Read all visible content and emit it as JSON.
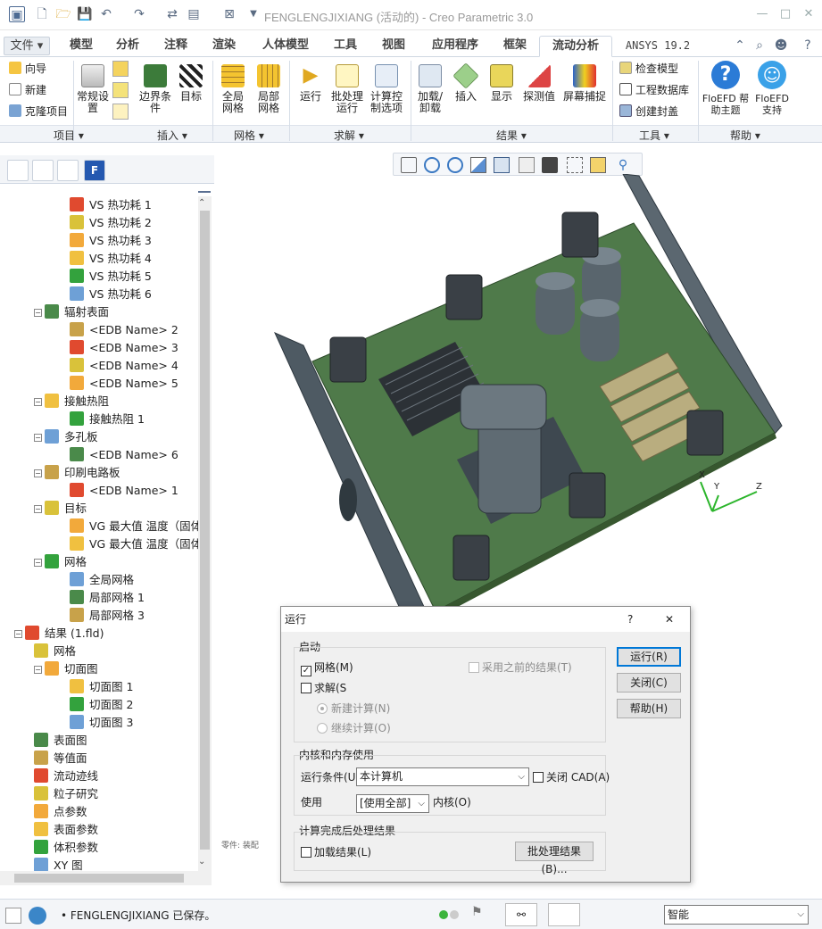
{
  "titlebar": {
    "title": "FENGLENGJIXIANG (活动的) - Creo Parametric 3.0"
  },
  "tabs": [
    "文件",
    "模型",
    "分析",
    "注释",
    "渲染",
    "人体模型",
    "工具",
    "视图",
    "应用程序",
    "框架",
    "流动分析",
    "ANSYS 19.2"
  ],
  "active_tab": "流动分析",
  "ribbon": {
    "project": {
      "items": [
        "向导",
        "新建",
        "克隆项目"
      ],
      "group": "项目"
    },
    "insert": {
      "buttons": [
        "常规设置",
        "边界条件",
        "目标"
      ],
      "group": "插入"
    },
    "mesh": {
      "buttons": [
        "全局网格",
        "局部网格"
      ],
      "group": "网格"
    },
    "solve": {
      "buttons": [
        "运行",
        "批处理运行",
        "计算控制选项"
      ],
      "group": "求解"
    },
    "results": {
      "buttons": [
        "加载/卸载",
        "插入",
        "显示",
        "探测值",
        "屏幕捕捉"
      ],
      "group": "结果"
    },
    "tools": {
      "items": [
        "检查模型",
        "工程数据库",
        "创建封盖"
      ],
      "group": "工具"
    },
    "help": {
      "buttons": [
        "FloEFD 帮助主题",
        "FloEFD 支持"
      ],
      "group": "帮助"
    }
  },
  "tree": [
    {
      "label": "VS 热功耗 1",
      "level": 3
    },
    {
      "label": "VS 热功耗 2",
      "level": 3
    },
    {
      "label": "VS 热功耗 3",
      "level": 3
    },
    {
      "label": "VS 热功耗 4",
      "level": 3
    },
    {
      "label": "VS 热功耗 5",
      "level": 3
    },
    {
      "label": "VS 热功耗 6",
      "level": 3
    },
    {
      "label": "辐射表面",
      "level": 2,
      "toggle": "-"
    },
    {
      "label": "<EDB Name> 2",
      "level": 3
    },
    {
      "label": "<EDB Name> 3",
      "level": 3
    },
    {
      "label": "<EDB Name> 4",
      "level": 3
    },
    {
      "label": "<EDB Name> 5",
      "level": 3
    },
    {
      "label": "接触热阻",
      "level": 2,
      "toggle": "-"
    },
    {
      "label": "接触热阻 1",
      "level": 3
    },
    {
      "label": "多孔板",
      "level": 2,
      "toggle": "-"
    },
    {
      "label": "<EDB Name> 6",
      "level": 3
    },
    {
      "label": "印刷电路板",
      "level": 2,
      "toggle": "-"
    },
    {
      "label": "<EDB Name> 1",
      "level": 3
    },
    {
      "label": "目标",
      "level": 2,
      "toggle": "-"
    },
    {
      "label": "VG 最大值 温度（固体",
      "level": 3
    },
    {
      "label": "VG 最大值 温度（固体",
      "level": 3
    },
    {
      "label": "网格",
      "level": 2,
      "toggle": "-"
    },
    {
      "label": "全局网格",
      "level": 3
    },
    {
      "label": "局部网格 1",
      "level": 3
    },
    {
      "label": "局部网格 3",
      "level": 3
    },
    {
      "label": "结果 (1.fld)",
      "level": 1,
      "toggle": "-"
    },
    {
      "label": "网格",
      "level": 2
    },
    {
      "label": "切面图",
      "level": 2,
      "toggle": "-"
    },
    {
      "label": "切面图 1",
      "level": 3
    },
    {
      "label": "切面图 2",
      "level": 3
    },
    {
      "label": "切面图 3",
      "level": 3
    },
    {
      "label": "表面图",
      "level": 2
    },
    {
      "label": "等值面",
      "level": 2
    },
    {
      "label": "流动迹线",
      "level": 2
    },
    {
      "label": "粒子研究",
      "level": 2
    },
    {
      "label": "点参数",
      "level": 2
    },
    {
      "label": "表面参数",
      "level": 2
    },
    {
      "label": "体积参数",
      "level": 2
    },
    {
      "label": "XY 图",
      "level": 2
    }
  ],
  "viewport": {
    "axis_x": "X",
    "axis_y": "Y",
    "axis_z": "Z",
    "watermark": "零件: 装配"
  },
  "dialog": {
    "title": "运行",
    "help": "?",
    "close": "✕",
    "startup": {
      "legend": "启动",
      "mesh": "网格(M)",
      "use_previous": "采用之前的结果(T)",
      "solve": "求解(S",
      "new_calc": "新建计算(N)",
      "continue_calc": "继续计算(O)"
    },
    "core": {
      "legend": "内核和内存使用",
      "run_at_label": "运行条件(U)",
      "run_at_value": "本计算机",
      "close_cad": "关闭 CAD(A)",
      "use_label": "使用",
      "use_value": "[使用全部]",
      "cores_label": "内核(O)"
    },
    "post": {
      "legend": "计算完成后处理结果",
      "load_results": "加载结果(L)",
      "batch_results": "批处理结果(B)..."
    },
    "buttons": {
      "run": "运行(R)",
      "close": "关闭(C)",
      "help": "帮助(H)"
    }
  },
  "status": {
    "message": "FENGLENGJIXIANG 已保存。",
    "filter": "智能"
  }
}
